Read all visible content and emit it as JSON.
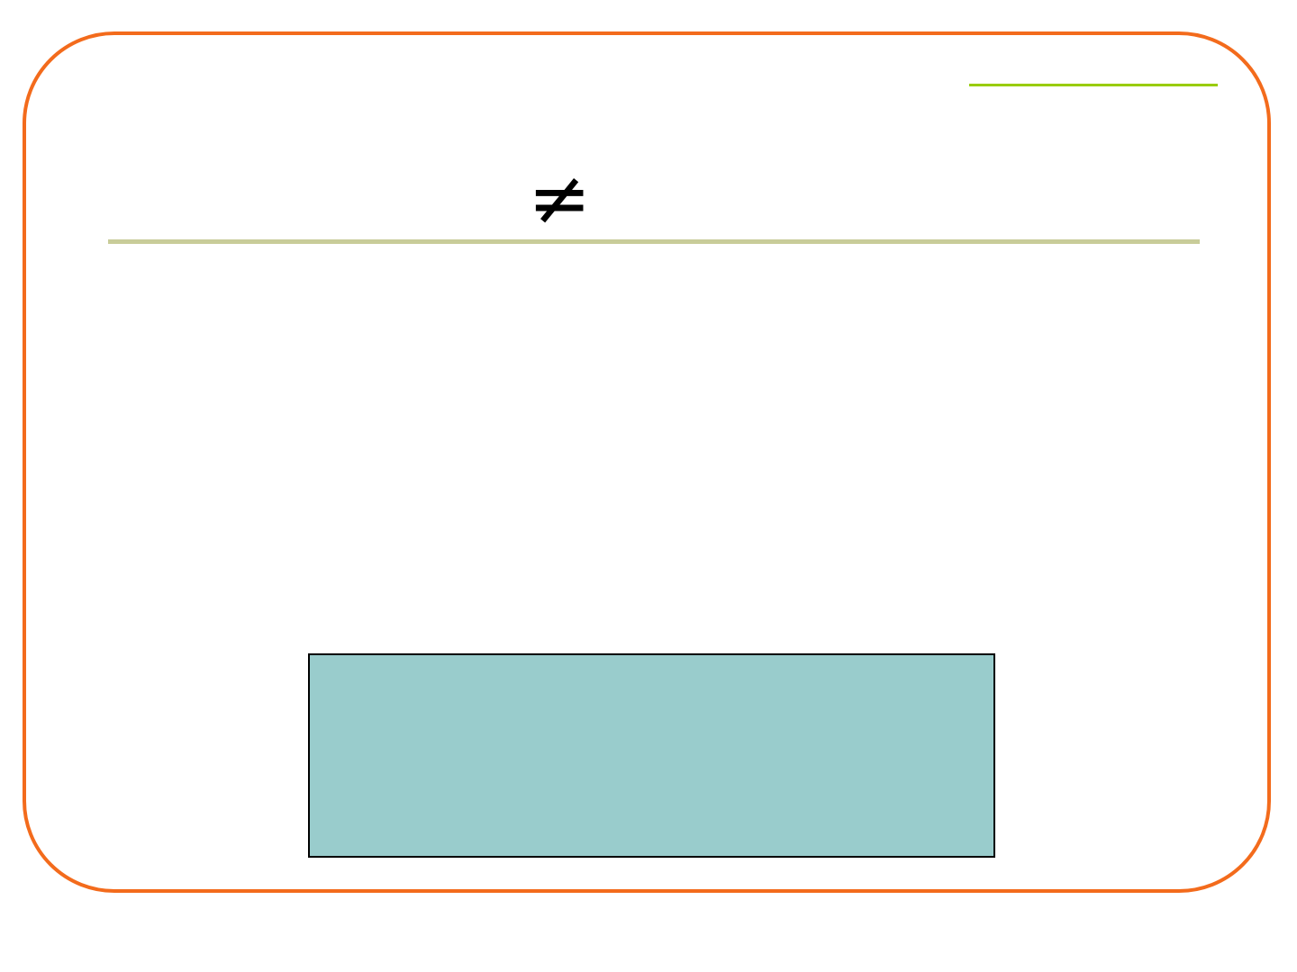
{
  "slide": {
    "symbol": "≠",
    "colors": {
      "frame_border": "#f36b1c",
      "accent_line": "#99cc00",
      "title_rule": "#c8cc99",
      "box_fill": "#99cccc",
      "box_border": "#000000"
    }
  }
}
